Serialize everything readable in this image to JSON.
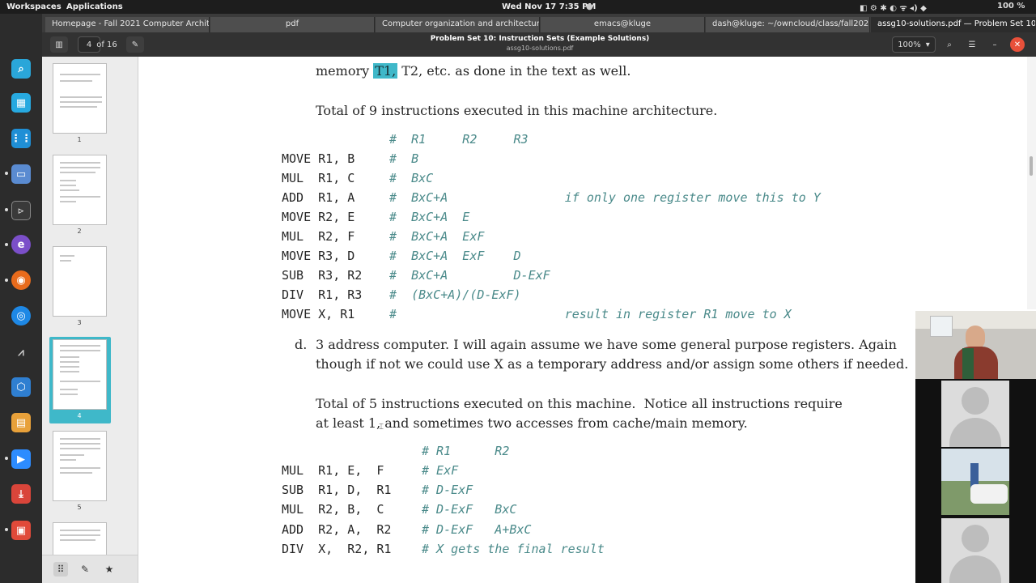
{
  "system_bar": {
    "workspaces": "Workspaces",
    "applications": "Applications",
    "datetime": "Wed Nov 17  7:35 PM",
    "battery": "100 %"
  },
  "tabs": [
    {
      "label": "Homepage - Fall 2021 Computer Architecte..."
    },
    {
      "label": "pdf"
    },
    {
      "label": "Computer organization and architectur..."
    },
    {
      "label": "emacs@kluge"
    },
    {
      "label": "dash@kluge: ~/owncloud/class/fall202..."
    },
    {
      "label": "assg10-solutions.pdf — Problem Set 10:..."
    }
  ],
  "header": {
    "page_current": "4",
    "page_total": "of 16",
    "title": "Problem Set 10: Instruction Sets (Example Solutions)",
    "subtitle": "assg10-solutions.pdf",
    "zoom": "100%"
  },
  "thumbnails": [
    "1",
    "2",
    "3",
    "4",
    "5"
  ],
  "document": {
    "top_line_pre": "memory ",
    "top_line_hl": "T1,",
    "top_line_post": " T2, etc. as done in the text as well.",
    "total9": "Total of 9 instructions executed in this machine architecture.",
    "code2": [
      {
        "code": "",
        "comment": "#  R1     R2     R3"
      },
      {
        "code": "MOVE R1, B",
        "comment": "#  B"
      },
      {
        "code": "MUL  R1, C",
        "comment": "#  BxC"
      },
      {
        "code": "ADD  R1, A",
        "comment": "#  BxC+A                if only one register move this to Y"
      },
      {
        "code": "MOVE R2, E",
        "comment": "#  BxC+A  E"
      },
      {
        "code": "MUL  R2, F",
        "comment": "#  BxC+A  ExF"
      },
      {
        "code": "MOVE R3, D",
        "comment": "#  BxC+A  ExF    D"
      },
      {
        "code": "SUB  R3, R2",
        "comment": "#  BxC+A         D-ExF"
      },
      {
        "code": "DIV  R1, R3",
        "comment": "#  (BxC+A)/(D-ExF)"
      },
      {
        "code": "MOVE X, R1",
        "comment": "#                       result in register R1 move to X"
      }
    ],
    "d_label": "d.",
    "d_line1": "3 address computer. I will again assume we have some general purpose registers. Again",
    "d_line2": "though if not we could use X as a temporary address and/or assign some others if needed.",
    "total5_line1": "Total of 5 instructions executed on this machine.  Notice all instructions require",
    "total5_line2": "at least 1, and sometimes two accesses from cache/main memory.",
    "code3": [
      {
        "code": "",
        "comment": "# R1      R2"
      },
      {
        "code": "MUL  R1, E,  F",
        "comment": "# ExF"
      },
      {
        "code": "SUB  R1, D,  R1",
        "comment": "# D-ExF"
      },
      {
        "code": "MUL  R2, B,  C",
        "comment": "# D-ExF   BxC"
      },
      {
        "code": "ADD  R2, A,  R2",
        "comment": "# D-ExF   A+BxC"
      },
      {
        "code": "DIV  X,  R2, R1",
        "comment": "# X gets the final result"
      }
    ]
  },
  "colors": {
    "highlight": "#3fb8c9",
    "comment": "#4a8a8a",
    "close_button": "#e8503a"
  }
}
